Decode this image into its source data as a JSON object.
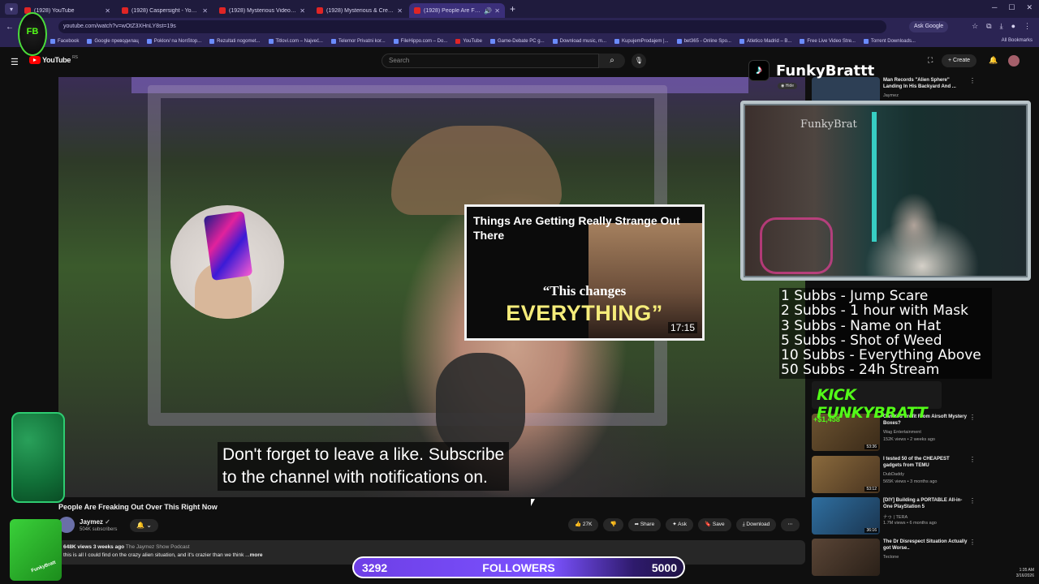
{
  "browser": {
    "tabs": [
      {
        "label": "(1928) YouTube",
        "active": false
      },
      {
        "label": "(1928) Caspersight - YouTube",
        "active": false
      },
      {
        "label": "(1928) Mysterious Videos That'l",
        "active": false
      },
      {
        "label": "(1928) Mysterious & Creepy Ti",
        "active": false
      },
      {
        "label": "(1928) People Are Freaking",
        "active": true
      }
    ],
    "url": "youtube.com/watch?v=wOtZ3XHnLY8st=19s",
    "ask_google": "Ask Google",
    "bookmarks": [
      "Facebook",
      "Google преводилац",
      "Poklon/ na NonStop...",
      "Rezultati nogomet...",
      "Titlovi.com – Najveć...",
      "Telemor Privatni kor...",
      "FileHippo.com – Do...",
      "YouTube",
      "Game-Debate PC g...",
      "Download music, m...",
      "KupujemProdajem |...",
      "bet365 - Online Spo...",
      "Atletico Madrid – B...",
      "Free Live Video Stre...",
      "Torrent Downloads..."
    ],
    "all_bookmarks": "All Bookmarks"
  },
  "youtube": {
    "logo_text": "YouTube",
    "region": "RS",
    "search_placeholder": "Search",
    "create_label": "Create",
    "notif_count": "9+"
  },
  "video": {
    "endcard_title": "Things Are Getting Really Strange Out There",
    "endcard_quote": "“This changes",
    "endcard_big": "EVERYTHING”",
    "endcard_duration": "17:15",
    "caption_line1": "Don't forget to leave a like. Subscribe",
    "caption_line2": "to the channel with notifications on.",
    "title": "People Are Freaking Out Over This Right Now",
    "channel": "Jaymez",
    "subscribers": "504K subscribers",
    "likes": "27K",
    "share": "Share",
    "ask": "Ask",
    "save": "Save",
    "download": "Download",
    "desc_meta": "648K views  3 weeks ago",
    "desc_podcast": "The Jaymez Show Podcast",
    "desc_text": "this is all I could find on the crazy alien situation, and it's crazier than we think ...",
    "desc_more": "more"
  },
  "sidebar": {
    "items": [
      {
        "title": "Man Records \"Alien Sphere\" Landing In His Backyard And ...",
        "channel": "Jaymez",
        "meta": "",
        "duration": "",
        "thumb": "#2d3f55"
      },
      {
        "title": "Can You Profit From Airsoft Mystery Boxes?",
        "channel": "Wag Entertainment",
        "meta": "152K views • 2 weeks ago",
        "duration": "53:36",
        "thumb": "#6b5230"
      },
      {
        "title": "I tested 50 of the CHEAPEST gadgets from TEMU",
        "channel": "DubDaddy",
        "meta": "565K views • 3 months ago",
        "duration": "53:12",
        "thumb": "#8a6a3d"
      },
      {
        "title": "[DIY] Building a PORTABLE All-in-One PlayStation 5",
        "channel": "ナゥ | TERA",
        "meta": "1.7M views • 6 months ago",
        "duration": "36:16",
        "thumb": "#2f6fa0"
      },
      {
        "title": "The Dr Disrespect Situation Actually got Worse..",
        "channel": "Tectone",
        "meta": "",
        "duration": "",
        "thumb": "#5a4536"
      }
    ]
  },
  "overlay": {
    "tiktok_name": "FunkyBrattt",
    "tiktok_hide": "Hide",
    "webcam_sign": "FunkyBrat",
    "goals": [
      "1 Subbs - Jump Scare",
      "2 Subbs - 1 hour with Mask",
      "3 Subbs - Name on Hat",
      "5 Subbs - Shot of Weed",
      "10 Subbs - Everything Above",
      "50 Subbs - 24h Stream"
    ],
    "kick_banner": "KICK FUNKYBRATT",
    "tip_amount": "+$1,458",
    "followers_current": "3292",
    "followers_label": "FOLLOWERS",
    "followers_goal": "5000",
    "channel_logo": "FB",
    "corner_badge": "FunkyBratt"
  },
  "system": {
    "time": "1:35 AM",
    "date": "3/16/2026"
  }
}
